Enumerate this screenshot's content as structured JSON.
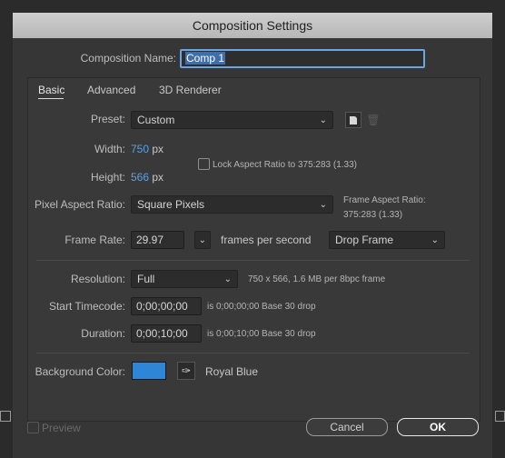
{
  "dialog": {
    "title": "Composition Settings"
  },
  "comp_name": {
    "label": "Composition Name:",
    "value": "Comp 1"
  },
  "tabs": [
    {
      "label": "Basic"
    },
    {
      "label": "Advanced"
    },
    {
      "label": "3D Renderer"
    }
  ],
  "preset": {
    "label": "Preset:",
    "value": "Custom"
  },
  "width": {
    "label": "Width:",
    "value": "750",
    "unit": "px"
  },
  "height": {
    "label": "Height:",
    "value": "566",
    "unit": "px"
  },
  "lock_aspect": {
    "label": "Lock Aspect Ratio to 375:283 (1.33)"
  },
  "pixel_aspect": {
    "label": "Pixel Aspect Ratio:",
    "value": "Square Pixels"
  },
  "frame_aspect": {
    "label": "Frame Aspect Ratio:",
    "value": "375:283 (1.33)"
  },
  "frame_rate": {
    "label": "Frame Rate:",
    "value": "29.97",
    "unit": "frames per second",
    "drop_frame": "Drop Frame"
  },
  "resolution": {
    "label": "Resolution:",
    "value": "Full",
    "info": "750 x 566, 1.6 MB per 8bpc frame"
  },
  "start_timecode": {
    "label": "Start Timecode:",
    "value": "0;00;00;00",
    "info": "is 0;00;00;00  Base 30  drop"
  },
  "duration": {
    "label": "Duration:",
    "value": "0;00;10;00",
    "info": "is 0;00;10;00  Base 30  drop"
  },
  "background": {
    "label": "Background Color:",
    "color": "#2f86d6",
    "name": "Royal Blue"
  },
  "footer": {
    "preview_label": "Preview",
    "cancel_label": "Cancel",
    "ok_label": "OK"
  },
  "colors": {
    "accent": "#5aa0e8",
    "dialog_bg": "#363636",
    "titlebar": "#c3c3c3"
  },
  "icons": {
    "save_preset": "save-preset-icon",
    "delete_preset": "trash-icon",
    "eyedropper": "eyedropper-icon"
  }
}
